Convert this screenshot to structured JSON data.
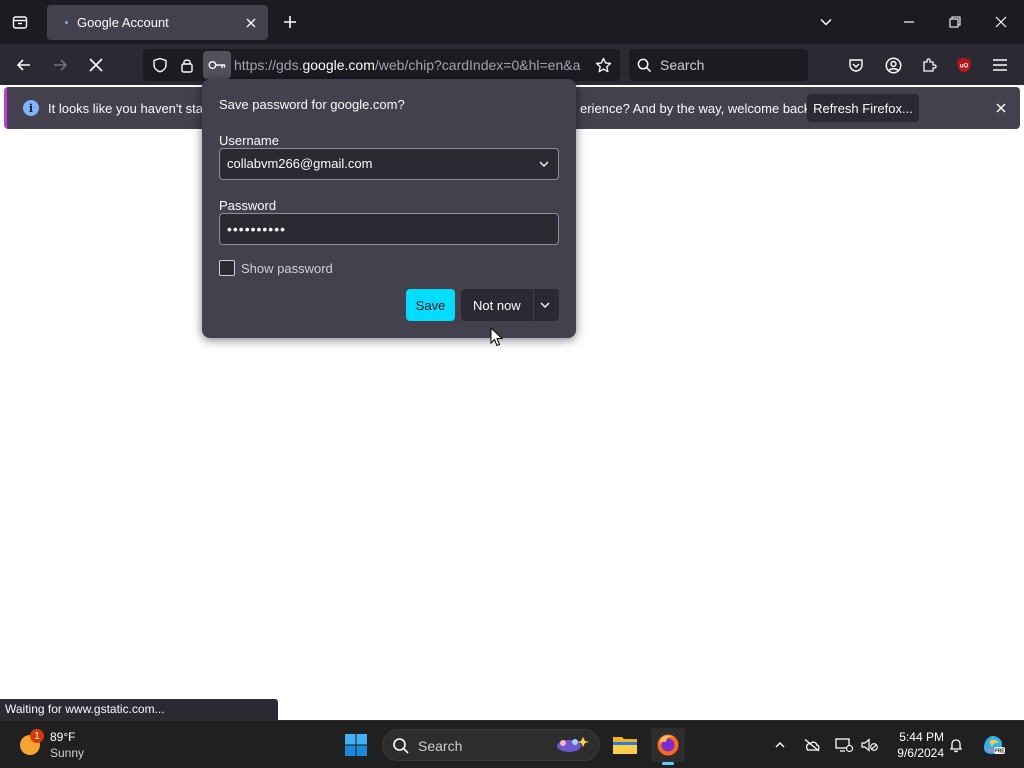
{
  "tab": {
    "title": "Google Account"
  },
  "navbar": {
    "url_prefix": "https://gds.",
    "url_domain": "google.com",
    "url_suffix": "/web/chip?cardIndex=0&hl=en&a",
    "search_placeholder": "Search"
  },
  "notification": {
    "message_left": "It looks like you haven't starte",
    "message_right": "erience? And by the way, welcome back!",
    "button_label": "Refresh Firefox..."
  },
  "password_panel": {
    "title": "Save password for google.com?",
    "username_label": "Username",
    "username_value": "collabvm266@gmail.com",
    "password_label": "Password",
    "password_value": "••••••••••",
    "show_password_label": "Show password",
    "show_password_checked": false,
    "save_label": "Save",
    "not_now_label": "Not now"
  },
  "status": {
    "text": "Waiting for www.gstatic.com..."
  },
  "taskbar": {
    "weather_badge": "1",
    "weather_temp": "89°F",
    "weather_condition": "Sunny",
    "search_label": "Search",
    "time": "5:44 PM",
    "date": "9/6/2024"
  },
  "colors": {
    "accent_button": "#00ddff",
    "notification_stripe": "#c23bd1",
    "ublock_red": "#c0141c"
  }
}
